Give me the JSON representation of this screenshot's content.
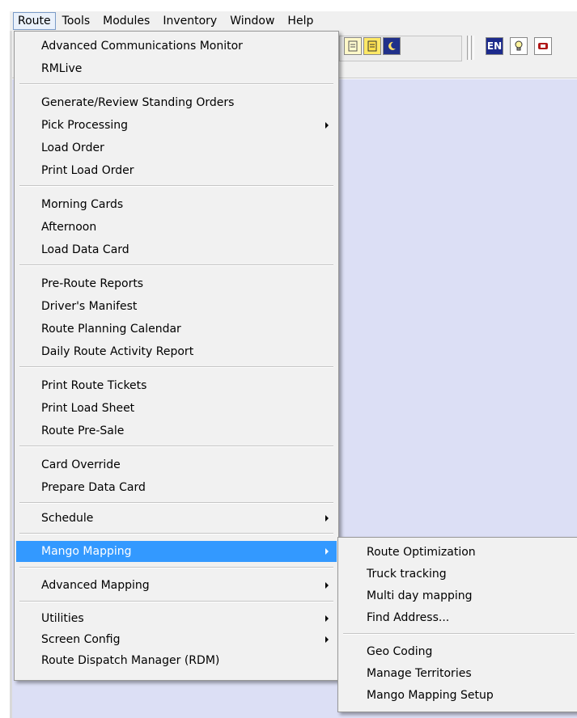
{
  "menubar": {
    "items": [
      {
        "label": "Route"
      },
      {
        "label": "Tools"
      },
      {
        "label": "Modules"
      },
      {
        "label": "Inventory"
      },
      {
        "label": "Window"
      },
      {
        "label": "Help"
      }
    ]
  },
  "toolbar": {
    "en_label": "EN"
  },
  "route_menu": {
    "items": [
      "Advanced Communications Monitor",
      "RMLive",
      "Generate/Review Standing Orders",
      "Pick Processing",
      "Load Order",
      "Print Load Order",
      "Morning Cards",
      "Afternoon",
      "Load Data Card",
      "Pre-Route Reports",
      "Driver's Manifest",
      "Route Planning Calendar",
      "Daily Route Activity Report",
      "Print Route Tickets",
      "Print Load Sheet",
      "Route Pre-Sale",
      "Card Override",
      "Prepare Data Card",
      "Schedule",
      "Mango Mapping",
      "Advanced Mapping",
      "Utilities",
      "Screen Config",
      "Route Dispatch Manager (RDM)"
    ]
  },
  "mango_submenu": {
    "items": [
      "Route Optimization",
      "Truck tracking",
      "Multi day mapping",
      "Find Address...",
      "Geo Coding",
      "Manage Territories",
      "Mango Mapping Setup"
    ]
  },
  "colors": {
    "highlight": "#3399ff",
    "workspace": "#dcdff5",
    "menu_bg": "#f1f1f1"
  }
}
